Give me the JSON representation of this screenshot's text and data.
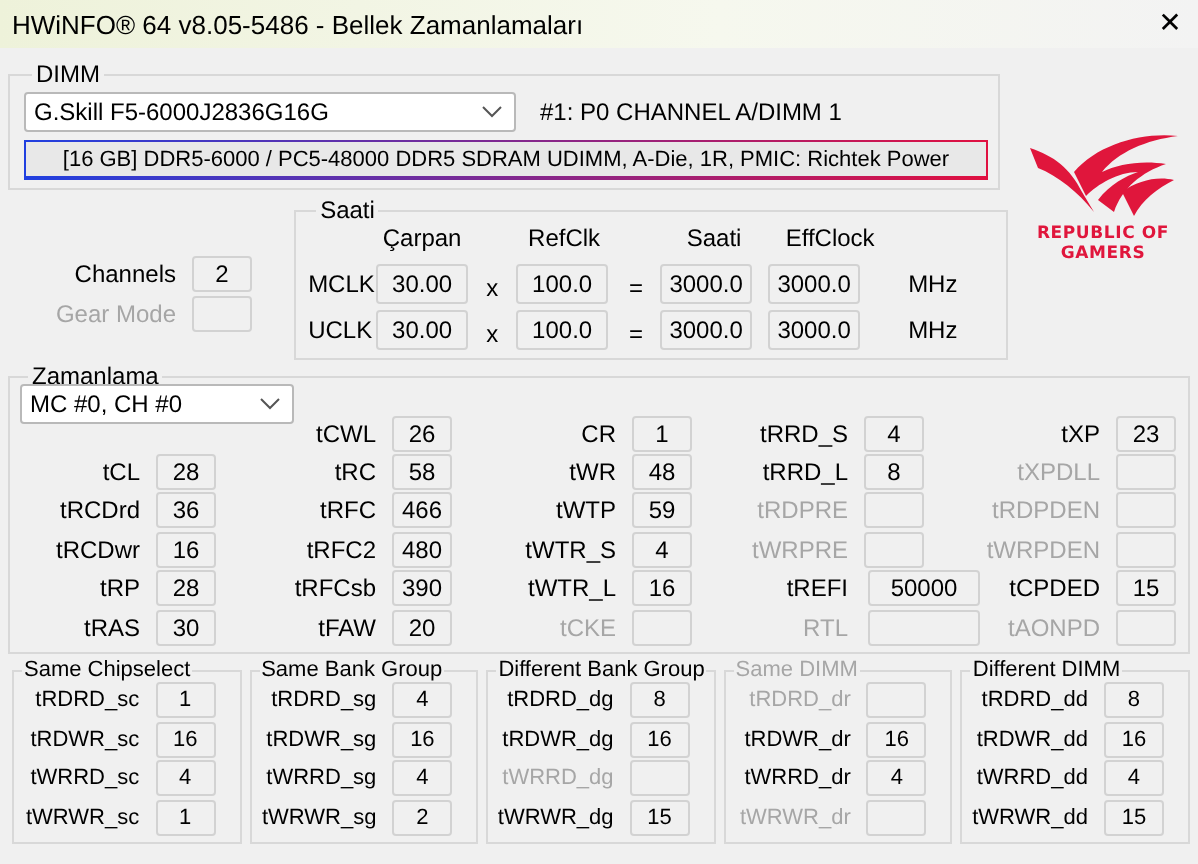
{
  "window": {
    "title": "HWiNFO® 64 v8.05-5486 - Bellek Zamanlamaları",
    "close": "✕"
  },
  "dimm": {
    "caption": "DIMM",
    "module": "G.Skill F5-6000J2836G16G",
    "slot": "#1: P0 CHANNEL A/DIMM 1",
    "info": "[16 GB] DDR5-6000 / PC5-48000 DDR5 SDRAM UDIMM, A-Die, 1R, PMIC: Richtek Power"
  },
  "logo_text": [
    "REPUBLIC OF",
    "GAMERS"
  ],
  "side_fields": [
    {
      "label": "Channels",
      "value": "2",
      "disabled": false
    },
    {
      "label": "Gear Mode",
      "disabled": true
    }
  ],
  "clock": {
    "caption": "Saati",
    "headers": [
      "Çarpan",
      "RefClk",
      "Saati",
      "EffClock"
    ],
    "rows": [
      {
        "label": "MCLK",
        "multiplier": "30.00",
        "times": "x",
        "refclk": "100.0",
        "equals": "=",
        "clock": "3000.0",
        "effclock": "3000.0",
        "unit": "MHz"
      },
      {
        "label": "UCLK",
        "multiplier": "30.00",
        "times": "x",
        "refclk": "100.0",
        "equals": "=",
        "clock": "3000.0",
        "effclock": "3000.0",
        "unit": "MHz"
      }
    ]
  },
  "timings": {
    "caption": "Zamanlama",
    "controller": "MC #0, CH #0",
    "columns": [
      {
        "items": [
          {
            "label": "tCL",
            "value": "28",
            "disabled": false
          },
          {
            "label": "tRCDrd",
            "value": "36",
            "disabled": false
          },
          {
            "label": "tRCDwr",
            "value": "16",
            "disabled": false
          },
          {
            "label": "tRP",
            "value": "28",
            "disabled": false
          },
          {
            "label": "tRAS",
            "value": "30",
            "disabled": false
          }
        ]
      },
      {
        "items": [
          {
            "label": "tCWL",
            "value": "26",
            "disabled": false
          },
          {
            "label": "tRC",
            "value": "58",
            "disabled": false
          },
          {
            "label": "tRFC",
            "value": "466",
            "disabled": false
          },
          {
            "label": "tRFC2",
            "value": "480",
            "disabled": false
          },
          {
            "label": "tRFCsb",
            "value": "390",
            "disabled": false
          },
          {
            "label": "tFAW",
            "value": "20",
            "disabled": false
          }
        ]
      },
      {
        "items": [
          {
            "label": "CR",
            "value": "1",
            "disabled": false
          },
          {
            "label": "tWR",
            "value": "48",
            "disabled": false
          },
          {
            "label": "tWTP",
            "value": "59",
            "disabled": false
          },
          {
            "label": "tWTR_S",
            "value": "4",
            "disabled": false
          },
          {
            "label": "tWTR_L",
            "value": "16",
            "disabled": false
          },
          {
            "label": "tCKE",
            "disabled": true
          }
        ]
      },
      {
        "items": [
          {
            "label": "tRRD_S",
            "value": "4",
            "disabled": false,
            "kind": "box"
          },
          {
            "label": "tRRD_L",
            "value": "8",
            "disabled": false,
            "kind": "box"
          },
          {
            "label": "tRDPRE",
            "disabled": true,
            "kind": "box"
          },
          {
            "label": "tWRPRE",
            "disabled": true,
            "kind": "box"
          },
          {
            "label": "tREFI",
            "value": "50000",
            "disabled": false,
            "kind": "wide"
          },
          {
            "label": "RTL",
            "disabled": true,
            "kind": "wide"
          }
        ]
      },
      {
        "items": [
          {
            "label": "tXP",
            "value": "23",
            "disabled": false
          },
          {
            "label": "tXPDLL",
            "disabled": true
          },
          {
            "label": "tRDPDEN",
            "disabled": true
          },
          {
            "label": "tWRPDEN",
            "disabled": true
          },
          {
            "label": "tCPDED",
            "value": "15",
            "disabled": false
          },
          {
            "label": "tAONPD",
            "disabled": true
          }
        ]
      }
    ]
  },
  "groups": [
    {
      "caption": "Same Chipselect",
      "disabled": false,
      "items": [
        {
          "label": "tRDRD_sc",
          "value": "1",
          "disabled": false
        },
        {
          "label": "tRDWR_sc",
          "value": "16",
          "disabled": false
        },
        {
          "label": "tWRRD_sc",
          "value": "4",
          "disabled": false
        },
        {
          "label": "tWRWR_sc",
          "value": "1",
          "disabled": false
        }
      ]
    },
    {
      "caption": "Same Bank Group",
      "disabled": false,
      "items": [
        {
          "label": "tRDRD_sg",
          "value": "4",
          "disabled": false
        },
        {
          "label": "tRDWR_sg",
          "value": "16",
          "disabled": false
        },
        {
          "label": "tWRRD_sg",
          "value": "4",
          "disabled": false
        },
        {
          "label": "tWRWR_sg",
          "value": "2",
          "disabled": false
        }
      ]
    },
    {
      "caption": "Different Bank Group",
      "disabled": false,
      "items": [
        {
          "label": "tRDRD_dg",
          "value": "8",
          "disabled": false
        },
        {
          "label": "tRDWR_dg",
          "value": "16",
          "disabled": false
        },
        {
          "label": "tWRRD_dg",
          "disabled": true
        },
        {
          "label": "tWRWR_dg",
          "value": "15",
          "disabled": false
        }
      ]
    },
    {
      "caption": "Same DIMM",
      "disabled": true,
      "items": [
        {
          "label": "tRDRD_dr",
          "disabled": true
        },
        {
          "label": "tRDWR_dr",
          "value": "16",
          "disabled": false
        },
        {
          "label": "tWRRD_dr",
          "value": "4",
          "disabled": false
        },
        {
          "label": "tWRWR_dr",
          "disabled": true
        }
      ]
    },
    {
      "caption": "Different DIMM",
      "disabled": false,
      "items": [
        {
          "label": "tRDRD_dd",
          "value": "8",
          "disabled": false
        },
        {
          "label": "tRDWR_dd",
          "value": "16",
          "disabled": false
        },
        {
          "label": "tWRRD_dd",
          "value": "4",
          "disabled": false
        },
        {
          "label": "tWRWR_dd",
          "value": "15",
          "disabled": false
        }
      ]
    }
  ]
}
